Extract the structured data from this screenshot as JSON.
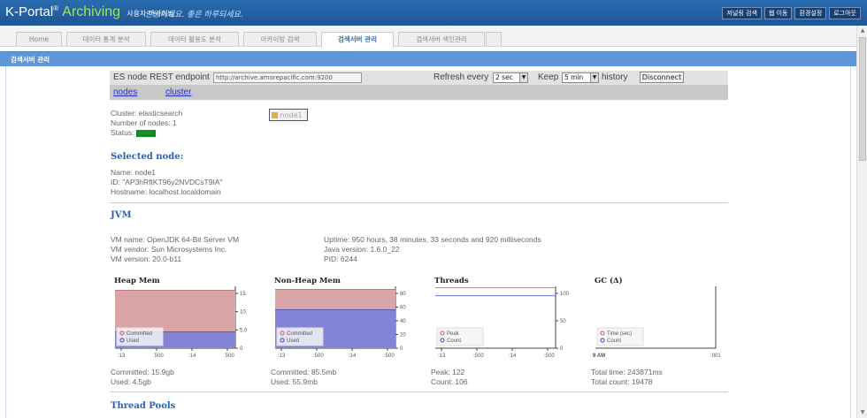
{
  "header": {
    "logo_main": "K-Portal",
    "logo_reg": "®",
    "logo_accent": "Archiving",
    "logo_sub": "사용자 아카이빙",
    "slogan": "안녕하세요. 좋은 하루되세요.",
    "buttons": [
      "저널링 검색",
      "웹 이동",
      "환경설정",
      "로그아웃"
    ]
  },
  "tabs": [
    "Home",
    "데이터 통계 분석",
    "데이터 활용도 분석",
    "아카이빙 검색",
    "검색서버 관리",
    "검색서버 색인관리"
  ],
  "active_tab": "검색서버 관리",
  "panel_title": "검색서버 관리",
  "es": {
    "endpoint_label": "ES node REST endpoint",
    "endpoint_value": "http://archive.amorepacific.com:9200",
    "refresh_label": "Refresh every",
    "refresh_value": "2 sec",
    "keep_label": "Keep",
    "keep_value": "5 min",
    "history_label": "history",
    "disconnect_label": "Disconnect",
    "links": [
      "nodes",
      "cluster"
    ]
  },
  "cluster": {
    "name_line": "Cluster: elasticsearch",
    "nodes_line": "Number of nodes: 1",
    "status_label": "Status:",
    "status_value": "green",
    "node_chip": "node1"
  },
  "selected_node": {
    "heading": "Selected node:",
    "name_line": "Name: node1",
    "id_line": "ID: \"AP3hRftKT96y2NVDCsT9IA\"",
    "host_line": "Hostname: localhost.localdomain"
  },
  "jvm": {
    "heading": "JVM",
    "left": [
      "VM name: OpenJDK 64-Bit Server VM",
      "VM vendor: Sun Microsystems Inc.",
      "VM version: 20.0-b11"
    ],
    "right": [
      "Uptime: 950 hours, 38 minutes, 33 seconds and 920 milliseconds",
      "Java version: 1.6.0_22",
      "PID: 6244"
    ]
  },
  "charts": {
    "heap": {
      "title": "Heap Mem",
      "legend": [
        "Committed",
        "Used"
      ],
      "footer": [
        "Committed: 15.9gb",
        "Used: 4.5gb"
      ]
    },
    "nonheap": {
      "title": "Non-Heap Mem",
      "legend": [
        "Committed",
        "Used"
      ],
      "footer": [
        "Committed: 85.5mb",
        "Used: 55.9mb"
      ]
    },
    "threads": {
      "title": "Threads",
      "legend": [
        "Peak",
        "Count"
      ],
      "footer": [
        "Peak: 122",
        "Count: 106"
      ]
    },
    "gc": {
      "title": "GC (Δ)",
      "legend": [
        "Time (sec)",
        "Count"
      ],
      "footer": [
        "Total time: 243871ms",
        "Total count: 19478"
      ]
    }
  },
  "chart_data": [
    {
      "type": "area",
      "title": "Heap Mem",
      "x": [
        ":13",
        ":500",
        ":14",
        ":500"
      ],
      "series": [
        {
          "name": "Committed",
          "values": [
            15.9,
            15.9,
            15.9,
            15.9
          ]
        },
        {
          "name": "Used",
          "values": [
            4.5,
            4.5,
            4.5,
            4.5
          ]
        }
      ],
      "yticks": [
        "15.",
        "10.",
        "5.0",
        "0"
      ],
      "ylim": [
        0,
        17
      ],
      "color_committed": "#d9a5a6",
      "color_used": "#8383d8"
    },
    {
      "type": "area",
      "title": "Non-Heap Mem",
      "x": [
        ":13",
        ":500",
        ":14",
        ":500"
      ],
      "series": [
        {
          "name": "Committed",
          "values": [
            85.5,
            85.5,
            85.5,
            85.5
          ]
        },
        {
          "name": "Used",
          "values": [
            55.9,
            55.9,
            55.9,
            55.9
          ]
        }
      ],
      "yticks": [
        "80",
        "60",
        "40",
        "20",
        "0"
      ],
      "ylim": [
        0,
        90
      ],
      "color_committed": "#d9a5a6",
      "color_used": "#8383d8"
    },
    {
      "type": "line",
      "title": "Threads",
      "x": [
        ":13",
        ":500",
        ":14",
        ":500"
      ],
      "series": [
        {
          "name": "Peak",
          "values": [
            122,
            122,
            122,
            122
          ]
        },
        {
          "name": "Count",
          "values": [
            106,
            106,
            106,
            106
          ]
        }
      ],
      "yticks": [
        "100",
        "50",
        "0"
      ],
      "ylim": [
        0,
        125
      ],
      "color_peak": "#d67a7a",
      "color_count": "#6b6bd6"
    },
    {
      "type": "line",
      "title": "GC (Δ)",
      "x": [
        "9 AM",
        ":001"
      ],
      "series": [
        {
          "name": "Time (sec)",
          "values": []
        },
        {
          "name": "Count",
          "values": []
        }
      ],
      "yticks": [],
      "color_time": "#d67a7a",
      "color_count": "#6b6bd6"
    }
  ],
  "thread_pools": {
    "heading": "Thread Pools"
  }
}
